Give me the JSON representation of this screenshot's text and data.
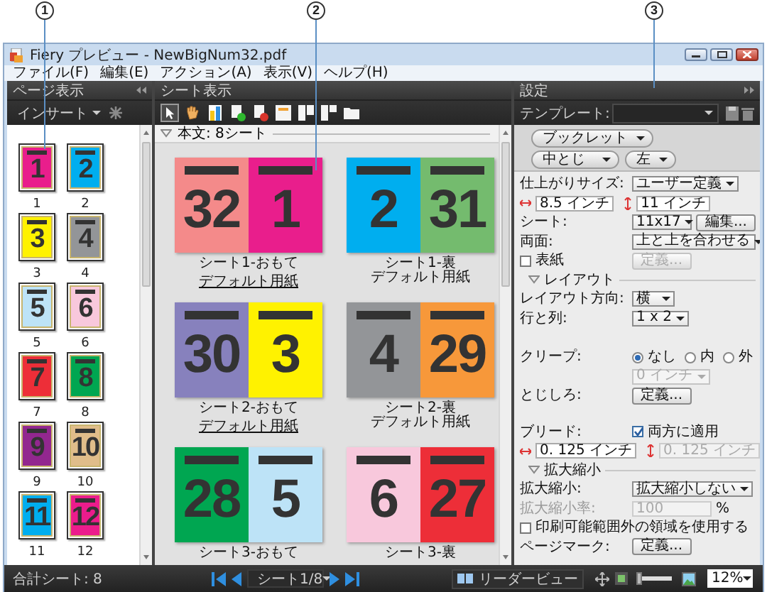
{
  "callouts": [
    "1",
    "2",
    "3"
  ],
  "window": {
    "title": "Fiery プレビュー - NewBigNum32.pdf"
  },
  "menu": [
    "ファイル(F)",
    "編集(E)",
    "アクション(A)",
    "表示(V)",
    "ヘルプ(H)"
  ],
  "page_panel": {
    "title": "ページ表示",
    "insert_button": "インサート",
    "pages": [
      {
        "number": "1",
        "label": "1",
        "color": "#e91e8c"
      },
      {
        "number": "2",
        "label": "2",
        "color": "#00aeef"
      },
      {
        "number": "3",
        "label": "3",
        "color": "#fff200"
      },
      {
        "number": "4",
        "label": "4",
        "color": "#939598"
      },
      {
        "number": "5",
        "label": "5",
        "color": "#bde3f7"
      },
      {
        "number": "6",
        "label": "6",
        "color": "#f8c8dc"
      },
      {
        "number": "7",
        "label": "7",
        "color": "#ed2e38"
      },
      {
        "number": "8",
        "label": "8",
        "color": "#00a651"
      },
      {
        "number": "9",
        "label": "9",
        "color": "#92278f"
      },
      {
        "number": "10",
        "label": "10",
        "color": "#e0bd8a"
      },
      {
        "number": "11",
        "label": "11",
        "color": "#00aeef"
      },
      {
        "number": "12",
        "label": "12",
        "color": "#ec1c8c"
      }
    ]
  },
  "sheet_panel": {
    "title": "シート表示",
    "section": "本文: 8シート",
    "sheets": [
      {
        "pages": [
          {
            "number": "32",
            "color": "#f48a8a"
          },
          {
            "number": "1",
            "color": "#e91e8c"
          }
        ],
        "caption": "シート1-おもて",
        "paper": "デフォルト用紙",
        "paper_link": true
      },
      {
        "pages": [
          {
            "number": "2",
            "color": "#00aeef"
          },
          {
            "number": "31",
            "color": "#74bb6e"
          }
        ],
        "caption": "シート1-裏",
        "paper": "デフォルト用紙",
        "paper_link": false
      },
      {
        "pages": [
          {
            "number": "30",
            "color": "#8781bd"
          },
          {
            "number": "3",
            "color": "#fff200"
          }
        ],
        "caption": "シート2-おもて",
        "paper": "デフォルト用紙",
        "paper_link": true
      },
      {
        "pages": [
          {
            "number": "4",
            "color": "#939598"
          },
          {
            "number": "29",
            "color": "#f7983a"
          }
        ],
        "caption": "シート2-裏",
        "paper": "デフォルト用紙",
        "paper_link": false
      },
      {
        "pages": [
          {
            "number": "28",
            "color": "#00a651"
          },
          {
            "number": "5",
            "color": "#bde3f7"
          }
        ],
        "caption": "シート3-おもて"
      },
      {
        "pages": [
          {
            "number": "6",
            "color": "#f8c8dc"
          },
          {
            "number": "27",
            "color": "#ed2e38"
          }
        ],
        "caption": "シート3-裏"
      }
    ]
  },
  "settings_panel": {
    "title": "設定",
    "template_label": "テンプレート:",
    "booklet_type": "ブックレット",
    "binding": "中とじ",
    "edge": "左",
    "rows": [
      {
        "kind": "dropdown",
        "label": "仕上がりサイズ:",
        "value": "ユーザー定義",
        "disabled": false
      },
      {
        "kind": "fields",
        "fields": [
          {
            "value": "8.5 インチ",
            "disabled": false
          },
          {
            "value": "11 インチ",
            "disabled": false
          }
        ]
      },
      {
        "kind": "dropdown-button",
        "label": "シート:",
        "value": "11x17",
        "button": "編集..."
      },
      {
        "kind": "dropdown",
        "label": "両面:",
        "value": "上と上を合わせる",
        "disabled": false
      },
      {
        "kind": "checkbox-button",
        "text": "表紙",
        "checked": false,
        "button": "定義...",
        "button_disabled": true
      },
      {
        "kind": "section",
        "label": "レイアウト"
      },
      {
        "kind": "dropdown",
        "label": "レイアウト方向:",
        "value": "横",
        "disabled": false
      },
      {
        "kind": "dropdown",
        "label": "行と列:",
        "value": "1 x 2",
        "disabled": false
      },
      {
        "kind": "radios",
        "label": "クリープ:",
        "options": [
          {
            "label": "なし",
            "selected": true
          },
          {
            "label": "内",
            "selected": false
          },
          {
            "label": "外",
            "selected": false
          }
        ]
      },
      {
        "kind": "dropdown",
        "value": "0 インチ",
        "disabled": true
      },
      {
        "kind": "button",
        "label": "とじしろ:",
        "button": "定義..."
      },
      {
        "kind": "checkbox",
        "label": "ブリード:",
        "text": "両方に適用",
        "checked": true
      },
      {
        "kind": "fields",
        "fields": [
          {
            "value": "0. 125 インチ",
            "disabled": false
          },
          {
            "value": "0. 125 インチ",
            "disabled": true
          }
        ]
      },
      {
        "kind": "section",
        "label": "拡大縮小"
      },
      {
        "kind": "dropdown",
        "label": "拡大縮小:",
        "value": "拡大縮小しない",
        "disabled": false
      },
      {
        "kind": "percent",
        "label": "拡大縮小率:",
        "value": "100",
        "unit": "%",
        "disabled": true
      },
      {
        "kind": "checkbox",
        "text": "印刷可能範囲外の領域を使用する",
        "checked": false
      },
      {
        "kind": "button",
        "label": "ページマーク:",
        "button": "定義..."
      }
    ]
  },
  "status_bar": {
    "total": "合計シート: 8",
    "sheet_select": "シート1/8",
    "reader_view": "リーダービュー",
    "level": 0.05,
    "zoom": "12%"
  }
}
